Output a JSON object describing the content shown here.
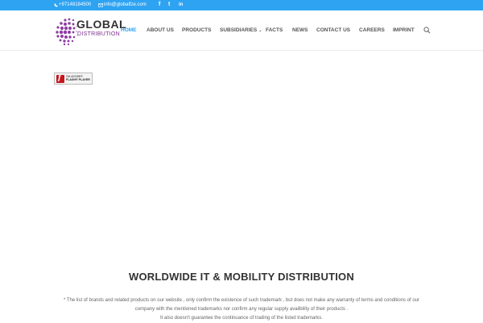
{
  "topbar": {
    "phone": "+97148184500",
    "email": "info@globalfze.com",
    "social": {
      "facebook": "f",
      "twitter": "t",
      "linkedin": "in"
    },
    "bg_color": "#2ea3f2"
  },
  "logo": {
    "word1": "GLOBAL",
    "word2": "DISTRIBUTION",
    "accent": "#7b2c8c"
  },
  "nav": {
    "items": [
      {
        "label": "HOME",
        "active": true
      },
      {
        "label": "ABOUT US"
      },
      {
        "label": "PRODUCTS"
      },
      {
        "label": "SUBSIDIARIES",
        "has_dropdown": true
      },
      {
        "label": "FACTS"
      },
      {
        "label": "NEWS"
      },
      {
        "label": "CONTACT US"
      },
      {
        "label": "CAREERS"
      },
      {
        "label": "IMPRINT"
      }
    ],
    "active_color": "#2ea3f2"
  },
  "flash_badge": {
    "line1": "Get ADOBE®",
    "line2": "FLASH® PLAYER"
  },
  "main": {
    "title": "WORLDWIDE IT & MOBILITY DISTRIBUTION",
    "disclaimer_lines": [
      "* The list of brands and related products on our website , only confirm the existence of such trademark , but does not make any warranty of terms and conditions of our",
      "company with the mentioned trademarks nor confirm any regular supply availbility of their products .",
      "It also doesn't guarantee the continuance of trading of the listed trademarks."
    ]
  }
}
